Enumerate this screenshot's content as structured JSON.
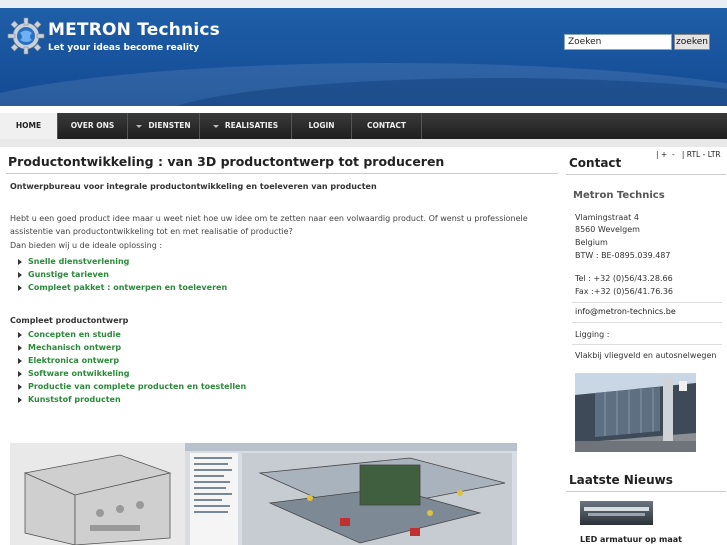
{
  "brand": {
    "title": "METRON Technics",
    "tagline": "Let your ideas become reality"
  },
  "search": {
    "value": "Zoeken",
    "button_label": "zoeken"
  },
  "nav": {
    "items": [
      {
        "label": "HOME",
        "active": true,
        "dropdown": false
      },
      {
        "label": "OVER ONS",
        "active": false,
        "dropdown": false
      },
      {
        "label": "DIENSTEN",
        "active": false,
        "dropdown": true
      },
      {
        "label": "REALISATIES",
        "active": false,
        "dropdown": true
      },
      {
        "label": "LOGIN",
        "active": false,
        "dropdown": false
      },
      {
        "label": "CONTACT",
        "active": false,
        "dropdown": false
      }
    ]
  },
  "main": {
    "title": "Productontwikkeling : van 3D productontwerp tot produceren",
    "subtitle": "Ontwerpbureau voor integrale productontwikkeling en toeleveren van producten",
    "intro": "Hebt u een goed product idee maar u weet niet hoe uw idee om te zetten naar een volwaardig product. Of wenst u professionele assistentie van productontwikkeling tot en met realisatie of productie?",
    "offer_intro": "Dan bieden wij u de ideale oplossing :",
    "offer_items": [
      "Snelle dienstverlening",
      "Gunstige tarieven",
      "Compleet pakket : ontwerpen en toeleveren"
    ],
    "section_heading": "Compleet productontwerp",
    "section_items": [
      "Concepten en studie",
      "Mechanisch ontwerp",
      "Elektronica ontwerp",
      "Software ontwikkeling",
      "Productie van complete producten en toestellen",
      "Kunststof producten"
    ]
  },
  "sidebar": {
    "text_controls": {
      "plus": "+",
      "minus": "-",
      "rtl_ltr": "RTL - LTR"
    },
    "contact_title": "Contact",
    "company": "Metron Technics",
    "address_lines": [
      "Vlamingstraat 4",
      "8560 Wevelgem",
      "Belgium",
      "BTW : BE-0895.039.487"
    ],
    "phone": "Tel : +32 (0)56/43.28.66",
    "fax": "Fax :+32 (0)56/41.76.36",
    "email": "info@metron-technics.be",
    "location_label": "Ligging :",
    "location_text": "Vlakbij vliegveld en autosnelwegen",
    "news_title": "Laatste Nieuws",
    "news_item": "LED armatuur op maat"
  },
  "colors": {
    "header_blue": "#1a56a0",
    "nav_dark": "#2a2a2a",
    "link_green": "#2a8b3a"
  }
}
